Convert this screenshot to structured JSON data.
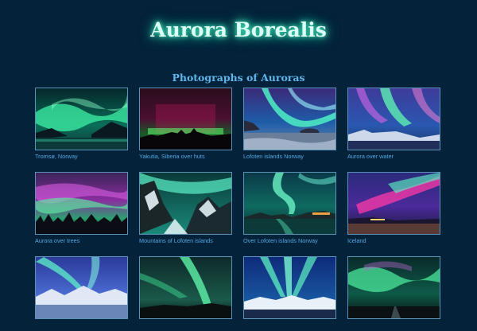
{
  "header": {
    "title": "Aurora Borealis"
  },
  "gallery": {
    "heading": "Photographs of Auroras",
    "photos": [
      {
        "caption": "Tromsø, Norway",
        "image": "aurora-photo"
      },
      {
        "caption": "Yakutia, Siberia over huts",
        "image": "aurora-photo"
      },
      {
        "caption": "Lofoten islands Norway",
        "image": "aurora-photo"
      },
      {
        "caption": "Aurora over water",
        "image": "aurora-photo"
      },
      {
        "caption": "Aurora over trees",
        "image": "aurora-photo"
      },
      {
        "caption": "Mountains of Lofoten islands",
        "image": "aurora-photo"
      },
      {
        "caption": "Over Lofoten islands Norway",
        "image": "aurora-photo"
      },
      {
        "caption": "Iceland",
        "image": "aurora-photo"
      },
      {
        "caption": "",
        "image": "aurora-photo"
      },
      {
        "caption": "",
        "image": "aurora-photo"
      },
      {
        "caption": "",
        "image": "aurora-photo"
      },
      {
        "caption": "",
        "image": "aurora-photo"
      }
    ]
  },
  "colors": {
    "background": "#04223a",
    "title_glow": "#4bf0c4",
    "heading": "#5fb6ea",
    "caption": "#53a8e2"
  }
}
